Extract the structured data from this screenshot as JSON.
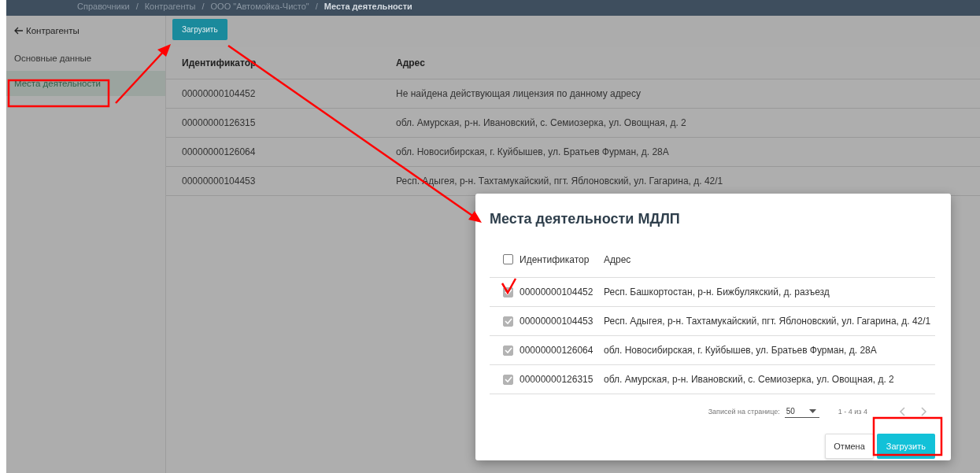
{
  "breadcrumb": [
    "Справочники",
    "Контрагенты",
    "ООО \"Автомойка-Чисто\"",
    "Места деятельности"
  ],
  "breadcrumb_separator": "/",
  "sidebar": {
    "back": "Контрагенты",
    "items": [
      {
        "label": "Основные данные",
        "selected": false
      },
      {
        "label": "Места деятельности",
        "selected": true
      }
    ]
  },
  "toolbar": {
    "load_button": "Загрузить"
  },
  "table": {
    "columns": [
      "Идентификатор",
      "Адрес"
    ],
    "rows": [
      [
        "00000000104452",
        "Не найдена действующая лицензия по данному адресу"
      ],
      [
        "00000000126315",
        "обл. Амурская, р-н. Ивановский, с. Семиозерка, ул. Овощная, д. 2"
      ],
      [
        "00000000126064",
        "обл. Новосибирская, г. Куйбышев, ул. Братьев Фурман, д. 28А"
      ],
      [
        "00000000104453",
        "Респ. Адыгея, р-н. Тахтамукайский, пгт. Яблоновский, ул. Гагарина, д. 42/1"
      ]
    ]
  },
  "dialog": {
    "title": "Места деятельности МДЛП",
    "columns": [
      "Идентификатор",
      "Адрес"
    ],
    "all_checked": false,
    "rows": [
      {
        "id": "00000000104452",
        "address": "Респ. Башкортостан, р-н. Бижбулякский, д. разъезд",
        "checked": true
      },
      {
        "id": "00000000104453",
        "address": "Респ. Адыгея, р-н. Тахтамукайский, пгт. Яблоновский, ул. Гагарина, д. 42/1",
        "checked": true
      },
      {
        "id": "00000000126064",
        "address": "обл. Новосибирская, г. Куйбышев, ул. Братьев Фурман, д. 28А",
        "checked": true
      },
      {
        "id": "00000000126315",
        "address": "обл. Амурская, р-н. Ивановский, с. Семиозерка, ул. Овощная, д. 2",
        "checked": true
      }
    ],
    "pagination": {
      "per_page_label": "Записей на странице:",
      "per_page": "50",
      "range": "1 - 4 из 4"
    },
    "buttons": {
      "cancel": "Отмена",
      "load": "Загрузить"
    }
  }
}
